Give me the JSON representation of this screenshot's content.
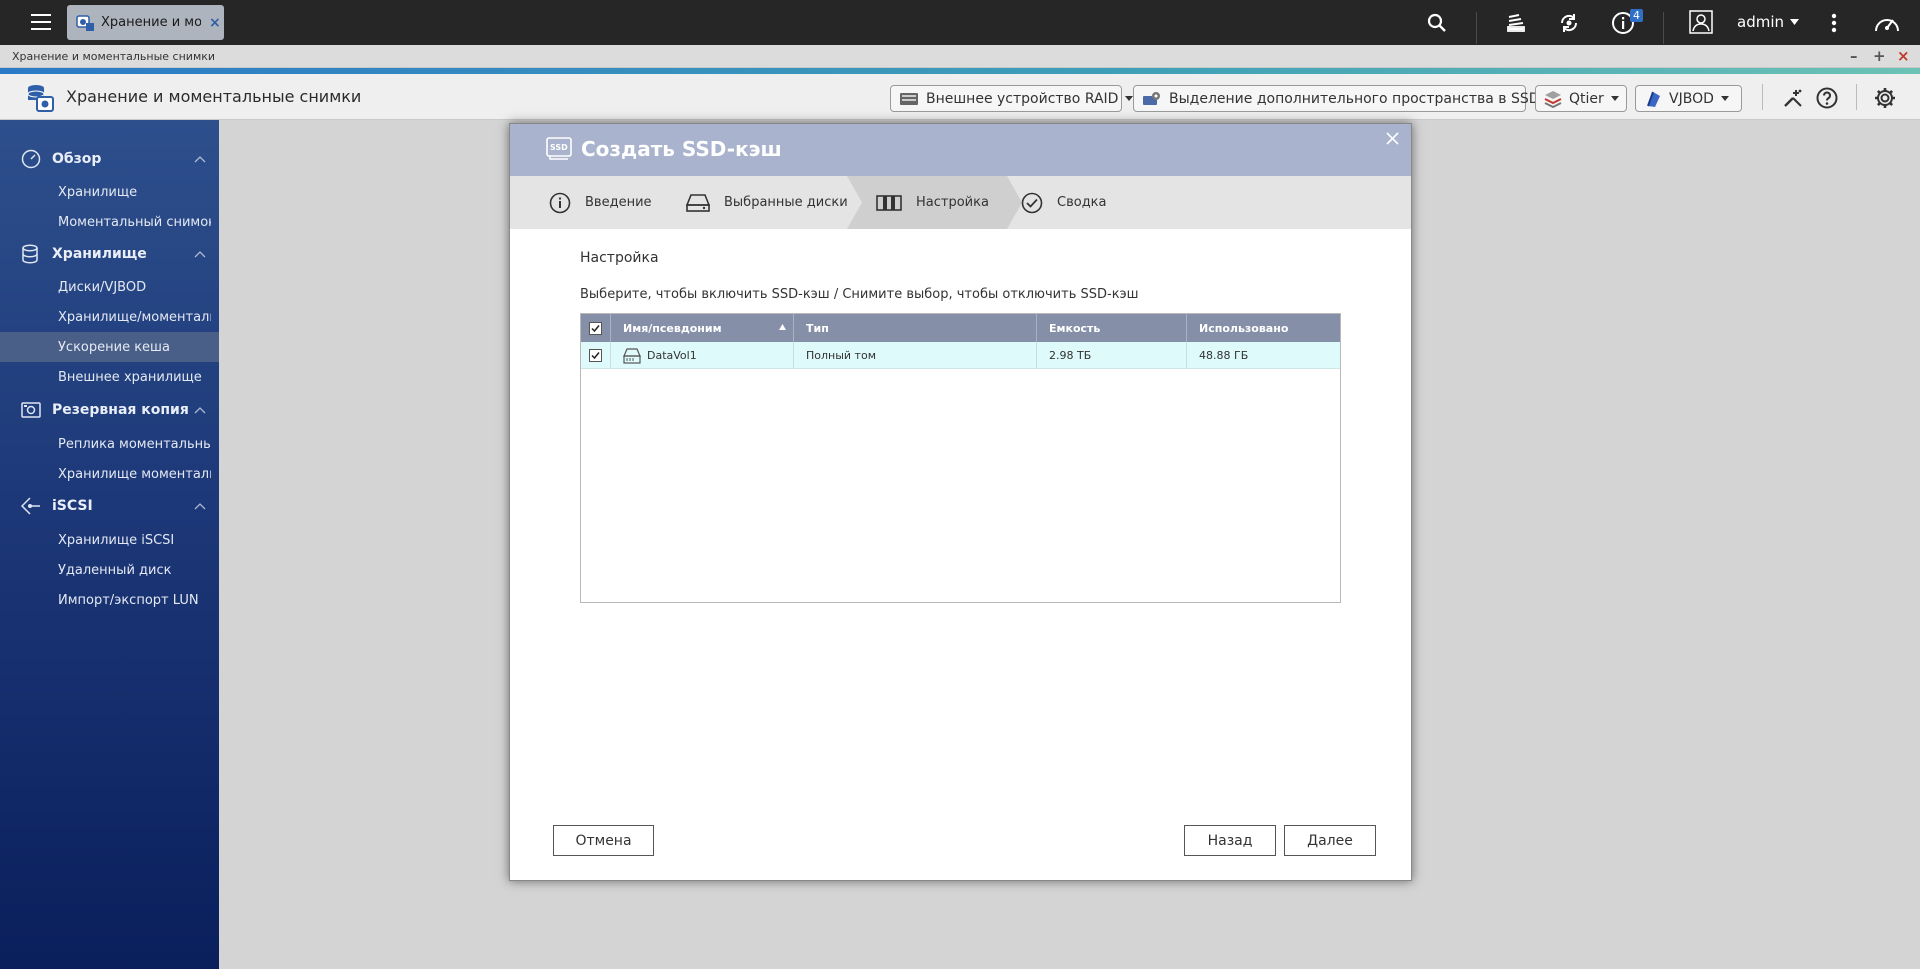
{
  "topbar": {
    "tab_label": "Хранение и мо...",
    "tab_close": "×",
    "notification_count": "4",
    "user": "admin"
  },
  "window": {
    "title": "Хранение и моментальные снимки",
    "minimize": "–",
    "maximize": "+",
    "close": "×"
  },
  "header": {
    "title": "Хранение и моментальные снимки",
    "buttons": [
      {
        "label": "Внешнее устройство RAID"
      },
      {
        "label": "Выделение дополнительного пространства в SSD"
      },
      {
        "label": "Qtier"
      },
      {
        "label": "VJBOD"
      }
    ]
  },
  "sidebar": {
    "sections": [
      {
        "title": "Обзор",
        "items": [
          "Хранилище",
          "Моментальный снимок"
        ]
      },
      {
        "title": "Хранилище",
        "items": [
          "Диски/VJBOD",
          "Хранилище/моментальн",
          "Ускорение кеша",
          "Внешнее хранилище"
        ]
      },
      {
        "title": "Резервная копия мо",
        "items": [
          "Реплика моментальных",
          "Хранилище моментальн"
        ]
      },
      {
        "title": "iSCSI",
        "items": [
          "Хранилище iSCSI",
          "Удаленный диск",
          "Импорт/экспорт LUN"
        ]
      }
    ],
    "active_item": "Ускорение кеша"
  },
  "dialog": {
    "title": "Создать SSD-кэш",
    "steps": [
      "Введение",
      "Выбранные диски",
      "Настройка",
      "Сводка"
    ],
    "current_step": "Настройка",
    "section_title": "Настройка",
    "description": "Выберите, чтобы включить SSD-кэш / Снимите выбор, чтобы отключить SSD-кэш",
    "table": {
      "columns": [
        "Имя/псевдоним",
        "Тип",
        "Емкость",
        "Использовано"
      ],
      "rows": [
        {
          "checked": true,
          "name": "DataVol1",
          "type": "Полный том",
          "capacity": "2.98 ТБ",
          "used": "48.88 ГБ"
        }
      ]
    },
    "buttons": {
      "cancel": "Отмена",
      "back": "Назад",
      "next": "Далее"
    }
  },
  "colors": {
    "sidebar_top": "#2d4f8c",
    "sidebar_bottom": "#0a1f5c",
    "dialog_header": "#a9b3cd",
    "table_header": "#8590a8",
    "selected_row": "#dffafa"
  }
}
